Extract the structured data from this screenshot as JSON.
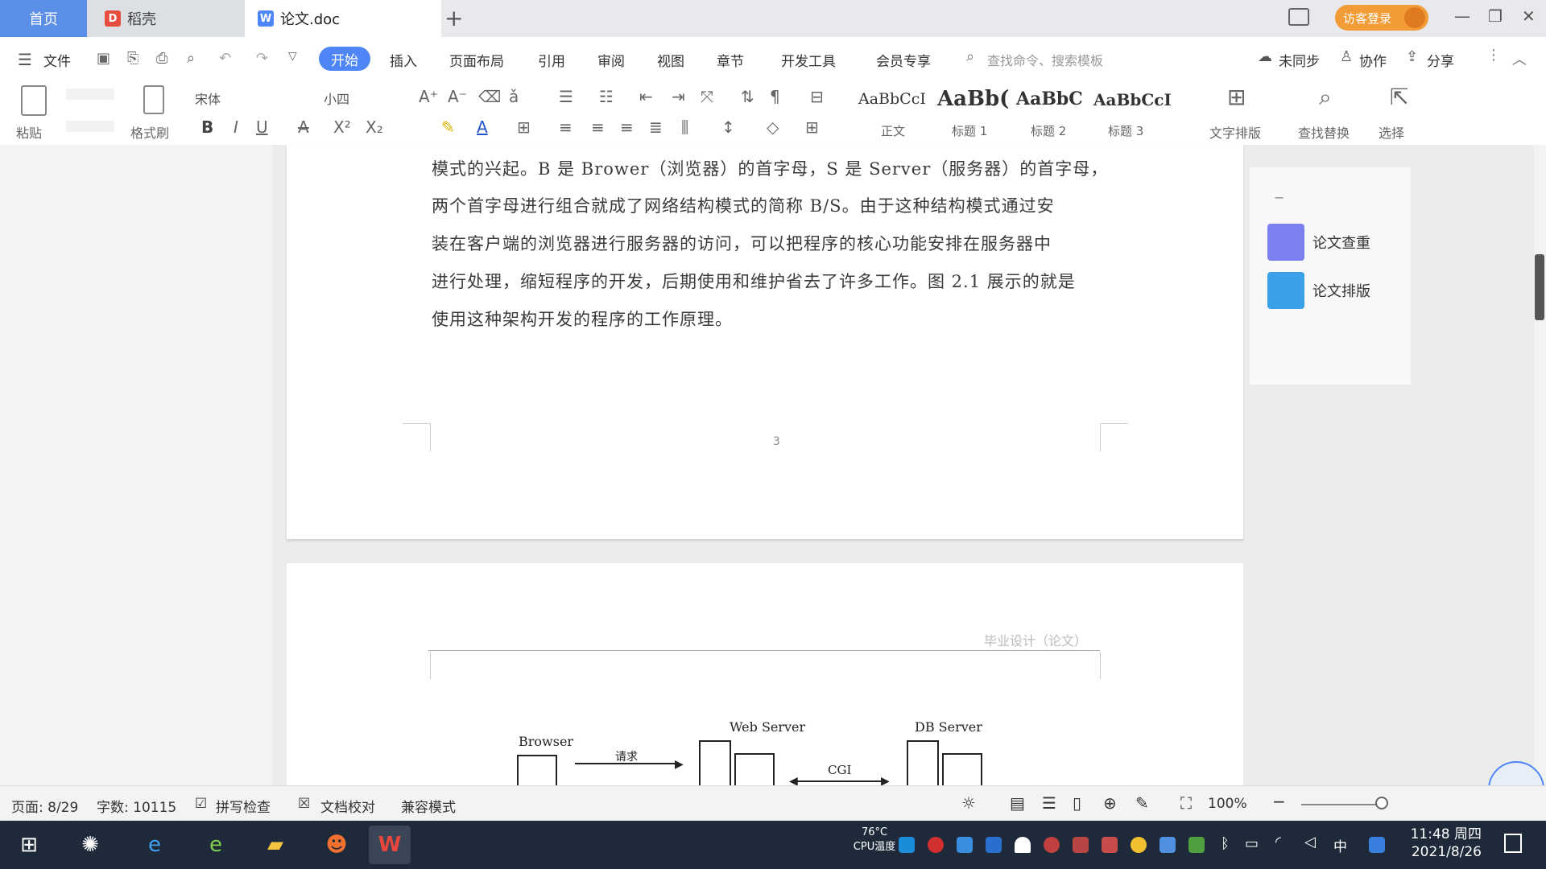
{
  "tabs": {
    "home": "首页",
    "daoke": "稻壳",
    "doc": "论文.doc",
    "new": "+"
  },
  "titlebar": {
    "login": "访客登录"
  },
  "menu": {
    "file": "文件",
    "items": [
      "开始",
      "插入",
      "页面布局",
      "引用",
      "审阅",
      "视图",
      "章节",
      "开发工具",
      "会员专享"
    ],
    "search": "查找命令、搜索模板",
    "sync": "未同步",
    "collab": "协作",
    "share": "分享"
  },
  "ribbon": {
    "paste": "粘贴",
    "format_painter": "格式刷",
    "font_name": "宋体",
    "font_size": "小四",
    "styles": [
      {
        "sample": "AaBbCcI",
        "label": "正文"
      },
      {
        "sample": "AaBb(",
        "label": "标题 1"
      },
      {
        "sample": "AaBbC",
        "label": "标题 2"
      },
      {
        "sample": "AaBbCcI",
        "label": "标题 3"
      }
    ],
    "text_layout": "文字排版",
    "find_replace": "查找替换",
    "select": "选择"
  },
  "document": {
    "lines": [
      "模式的兴起。B 是 Brower（浏览器）的首字母，S 是 Server（服务器）的首字母，",
      "两个首字母进行组合就成了网络结构模式的简称 B/S。由于这种结构模式通过安",
      "装在客户端的浏览器进行服务器的访问，可以把程序的核心功能安排在服务器中",
      "进行处理，缩短程序的开发，后期使用和维护省去了许多工作。图 2.1 展示的就是",
      "使用这种架构开发的程序的工作原理。"
    ],
    "page_number": "3",
    "header": "毕业设计（论文）",
    "diagram": {
      "browser": "Browser",
      "web_server": "Web Server",
      "db_server": "DB Server",
      "request": "请求",
      "cgi": "CGI"
    }
  },
  "right_panel": {
    "items": [
      "论文查重",
      "论文排版"
    ]
  },
  "status": {
    "page": "页面: 8/29",
    "words": "字数: 10115",
    "spellcheck": "拼写检查",
    "proofread": "文档校对",
    "compat": "兼容模式",
    "zoom": "100%"
  },
  "taskbar": {
    "cpu_temp": "76°C",
    "cpu_label": "CPU温度",
    "ime": "中",
    "time": "11:48 周四",
    "date": "2021/8/26"
  },
  "colors": {
    "accent": "#4f86f7",
    "login": "#f29c38",
    "taskbar": "#1e2a3a"
  }
}
